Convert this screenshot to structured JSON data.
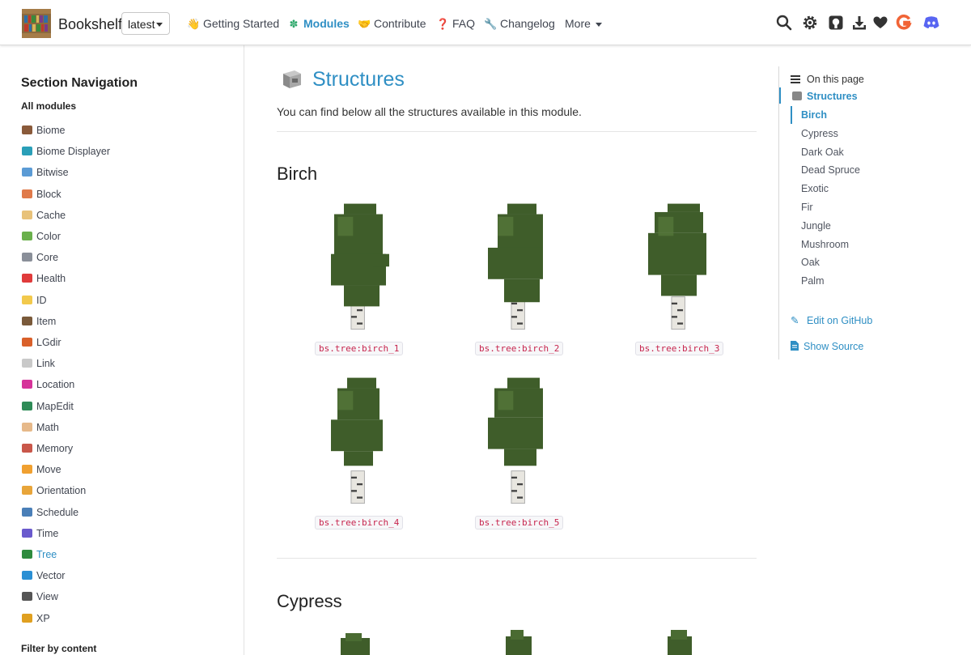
{
  "header": {
    "brand": "Bookshelf",
    "version": "latest",
    "nav": [
      {
        "icon": "waving-hand-icon",
        "glyph": "👋",
        "label": "Getting Started",
        "active": false
      },
      {
        "icon": "clover-icon",
        "glyph": "✽",
        "label": "Modules",
        "active": true
      },
      {
        "icon": "handshake-icon",
        "glyph": "🤝",
        "label": "Contribute",
        "active": false
      },
      {
        "icon": "question-mark-icon",
        "glyph": "❓",
        "label": "FAQ",
        "active": false
      },
      {
        "icon": "wrench-icon",
        "glyph": "🔧",
        "label": "Changelog",
        "active": false
      },
      {
        "icon": "",
        "glyph": "",
        "label": "More",
        "active": false
      }
    ]
  },
  "sidebar": {
    "title": "Section Navigation",
    "all_label": "All modules",
    "items": [
      {
        "label": "Biome",
        "icon": "biome-icon",
        "color": "#8a5a3a"
      },
      {
        "label": "Biome Displayer",
        "icon": "biome-displayer-icon",
        "color": "#2a9fb8"
      },
      {
        "label": "Bitwise",
        "icon": "bitwise-icon",
        "color": "#5b9bd5"
      },
      {
        "label": "Block",
        "icon": "block-icon",
        "color": "#e07a4a"
      },
      {
        "label": "Cache",
        "icon": "cache-icon",
        "color": "#e8c27a"
      },
      {
        "label": "Color",
        "icon": "color-icon",
        "color": "#6ab04c"
      },
      {
        "label": "Core",
        "icon": "core-icon",
        "color": "#8a8f99"
      },
      {
        "label": "Health",
        "icon": "health-icon",
        "color": "#e03b3b"
      },
      {
        "label": "ID",
        "icon": "id-icon",
        "color": "#f2c94c"
      },
      {
        "label": "Item",
        "icon": "item-icon",
        "color": "#7a5a3a"
      },
      {
        "label": "LGdir",
        "icon": "lgdir-icon",
        "color": "#d9602a"
      },
      {
        "label": "Link",
        "icon": "link-icon",
        "color": "#c9c9c9"
      },
      {
        "label": "Location",
        "icon": "location-icon",
        "color": "#d6339a"
      },
      {
        "label": "MapEdit",
        "icon": "mapedit-icon",
        "color": "#2e8b57"
      },
      {
        "label": "Math",
        "icon": "math-icon",
        "color": "#e6b98a"
      },
      {
        "label": "Memory",
        "icon": "memory-icon",
        "color": "#c9574a"
      },
      {
        "label": "Move",
        "icon": "move-icon",
        "color": "#f0a030"
      },
      {
        "label": "Orientation",
        "icon": "orientation-icon",
        "color": "#e8a53a"
      },
      {
        "label": "Schedule",
        "icon": "schedule-icon",
        "color": "#4a7fb8"
      },
      {
        "label": "Time",
        "icon": "time-icon",
        "color": "#6a5acd"
      },
      {
        "label": "Tree",
        "icon": "tree-icon",
        "color": "#2e8b3e",
        "active": true
      },
      {
        "label": "Vector",
        "icon": "vector-icon",
        "color": "#2a8fd4"
      },
      {
        "label": "View",
        "icon": "view-icon",
        "color": "#555555"
      },
      {
        "label": "XP",
        "icon": "xp-icon",
        "color": "#e0a020"
      }
    ],
    "filter_label": "Filter by content"
  },
  "main": {
    "title": "Structures",
    "intro": "You can find below all the structures available in this module.",
    "sections": [
      {
        "heading": "Birch",
        "structures": [
          "bs.tree:birch_1",
          "bs.tree:birch_2",
          "bs.tree:birch_3",
          "bs.tree:birch_4",
          "bs.tree:birch_5"
        ]
      },
      {
        "heading": "Cypress",
        "structures": []
      }
    ]
  },
  "toc": {
    "header": "On this page",
    "root": "Structures",
    "items": [
      "Birch",
      "Cypress",
      "Dark Oak",
      "Dead Spruce",
      "Exotic",
      "Fir",
      "Jungle",
      "Mushroom",
      "Oak",
      "Palm"
    ],
    "active": "Birch",
    "edit_label": "Edit on GitHub",
    "source_label": "Show Source"
  },
  "colors": {
    "accent": "#2f8fc4",
    "leaf": "#3f5d2a",
    "code": "#c7254e"
  }
}
